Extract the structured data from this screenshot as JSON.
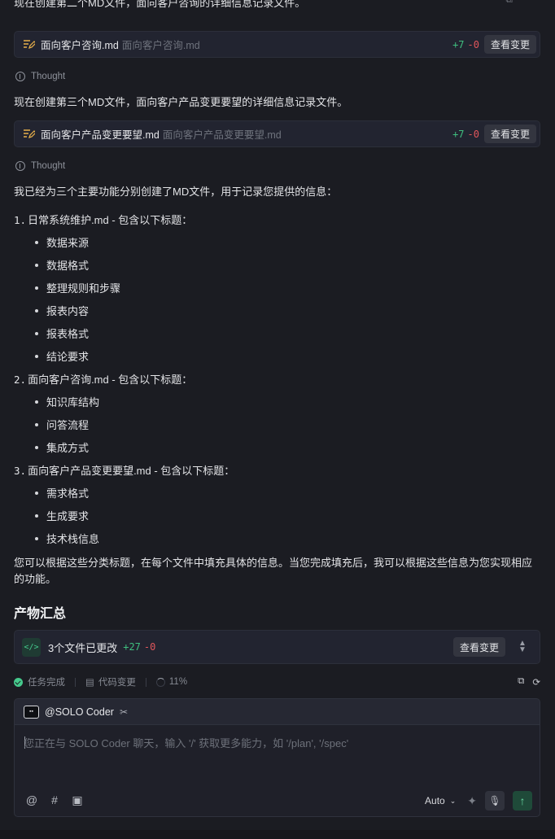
{
  "top_text": "现在创建第二个MD文件，面向客户咨询的详细信息记录文件。",
  "view_changes_label": "查看变更",
  "file_changes": [
    {
      "name": "面向客户咨询.md",
      "path": "面向客户咨询.md",
      "added": "+7",
      "removed": "-0"
    },
    {
      "name": "面向客户产品变更要望.md",
      "path": "面向客户产品变更要望.md",
      "added": "+7",
      "removed": "-0"
    }
  ],
  "thought_label": "Thought",
  "para_third": "现在创建第三个MD文件，面向客户产品变更要望的详细信息记录文件。",
  "para_summary": "我已经为三个主要功能分别创建了MD文件，用于记录您提供的信息：",
  "list": [
    {
      "num": "1.",
      "title": "日常系统维护.md - 包含以下标题：",
      "items": [
        "数据来源",
        "数据格式",
        "整理规则和步骤",
        "报表内容",
        "报表格式",
        "结论要求"
      ]
    },
    {
      "num": "2.",
      "title": "面向客户咨询.md - 包含以下标题：",
      "items": [
        "知识库结构",
        "问答流程",
        "集成方式"
      ]
    },
    {
      "num": "3.",
      "title": "面向客户产品变更要望.md - 包含以下标题：",
      "items": [
        "需求格式",
        "生成要求",
        "技术栈信息"
      ]
    }
  ],
  "closing_para": "您可以根据这些分类标题，在每个文件中填充具体的信息。当您完成填充后，我可以根据这些信息为您实现相应的功能。",
  "section_title": "产物汇总",
  "summary": {
    "label": "3个文件已更改",
    "added": "+27",
    "removed": "-0",
    "button": "查看变更"
  },
  "status": {
    "task": "任务完成",
    "code": "代码变更",
    "progress": "11%"
  },
  "composer": {
    "agent": "@SOLO Coder",
    "placeholder": "您正在与 SOLO Coder 聊天，输入 '/' 获取更多能力，如 '/plan', '/spec'",
    "model": "Auto"
  },
  "icons": [
    "edit-file-icon",
    "thought-icon",
    "code-icon",
    "chevron-updown-icon",
    "check-icon",
    "diff-icon",
    "progress-ring-icon",
    "copy-icon",
    "refresh-icon",
    "bot-icon",
    "tools-icon",
    "at-icon",
    "hash-icon",
    "image-icon",
    "sparkle-icon",
    "mic-icon",
    "send-icon"
  ],
  "colors": {
    "background": "#1b1c22",
    "added": "#3fbf7f",
    "removed": "#e0565b",
    "accent": "#45c98c"
  }
}
